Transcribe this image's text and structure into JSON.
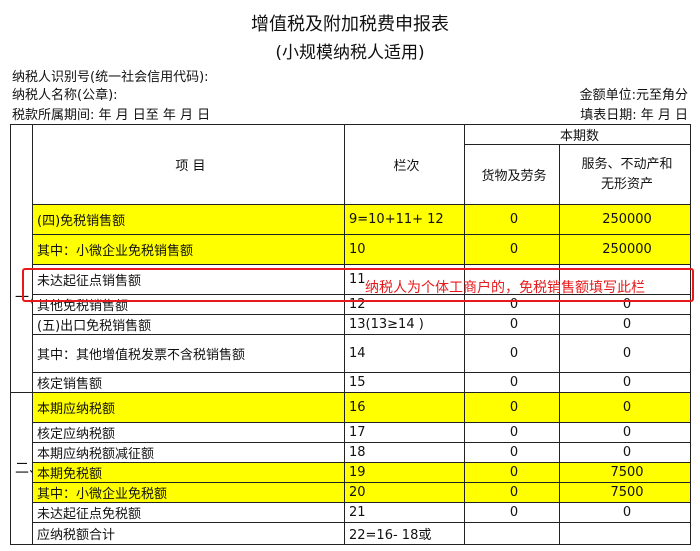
{
  "title": "增值税及附加税费申报表",
  "subtitle": "(小规模纳税人适用)",
  "meta": {
    "taxpayer_id": "纳税人识别号(统一社会信用代码):",
    "taxpayer_name": "纳税人名称(公章):",
    "amount_unit": "金额单位:元至角分",
    "period": "税款所属期间:   年  月  日至   年  月  日",
    "fill_date": "填表日期:   年  月  日"
  },
  "header": {
    "item": "项          目",
    "col_no": "栏次",
    "current_period": "本期数",
    "goods": "货物及劳务",
    "services_line1": "服务、不动产和",
    "services_line2": "无形资产"
  },
  "sections": {
    "section1": "一，计税依据",
    "section2": "二、税款计算"
  },
  "rows": [
    {
      "item": "(四)免税销售额",
      "col": "9=10+11+ 12",
      "goods": "0",
      "services": "250000"
    },
    {
      "item": "其中：小微企业免税销售额",
      "col": "10",
      "goods": "0",
      "services": "250000"
    },
    {
      "item": "未达起征点销售额",
      "col": "11",
      "goods": "",
      "services": ""
    },
    {
      "item": "其他免税销售额",
      "col": "12",
      "goods": "0",
      "services": "0"
    },
    {
      "item": "(五)出口免税销售额",
      "col": "13(13≥14 )",
      "goods": "0",
      "services": "0"
    },
    {
      "item": "其中：其他增值税发票不含税销售额",
      "col": "14",
      "goods": "0",
      "services": "0"
    },
    {
      "item": "核定销售额",
      "col": "15",
      "goods": "0",
      "services": "0"
    },
    {
      "item": "本期应纳税额",
      "col": "16",
      "goods": "0",
      "services": "0"
    },
    {
      "item": "核定应纳税额",
      "col": "17",
      "goods": "0",
      "services": "0"
    },
    {
      "item": "本期应纳税额减征额",
      "col": "18",
      "goods": "0",
      "services": "0"
    },
    {
      "item": "本期免税额",
      "col": "19",
      "goods": "0",
      "services": "7500"
    },
    {
      "item": "其中：小微企业免税额",
      "col": "20",
      "goods": "0",
      "services": "7500"
    },
    {
      "item": "未达起征点免税额",
      "col": "21",
      "goods": "0",
      "services": "0"
    },
    {
      "item": "应纳税额合计",
      "col": "22=16-  18或",
      "goods": "",
      "services": ""
    }
  ],
  "annotation": "纳税人为个体工商户的，免税销售额填写此栏",
  "colors": {
    "highlight": "#ffff00",
    "annotation": "#e8191b"
  }
}
